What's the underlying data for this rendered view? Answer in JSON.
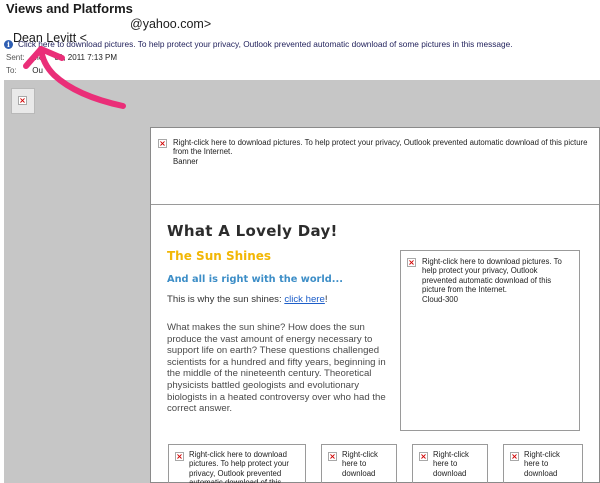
{
  "message": {
    "subject": "Views and Platforms",
    "sender_name": "Dean Levitt <",
    "sender_domain": "@yahoo.com>",
    "infobar_text": "Click here to download pictures. To help protect your privacy, Outlook prevented automatic download of some pictures in this message.",
    "sent_label": "Sent:",
    "sent_value": "Mo     31, 2011 7:13 PM",
    "to_label": "To:",
    "to_value": "Ou"
  },
  "newsletter": {
    "banner_placeholder": "Right-click here to download pictures.  To help protect your privacy, Outlook prevented automatic download of this picture from the Internet.",
    "banner_alt": "Banner",
    "headline": "What A Lovely Day!",
    "sun_title": "The Sun Shines",
    "right_title": "And all is right with the world...",
    "why_prefix": "This is why the sun shines: ",
    "why_link": "click here",
    "why_suffix": "!",
    "paragraph": "What makes the sun shine? How does the sun produce the vast amount of energy necessary to support life on earth? These questions challenged scientists for a hundred and fifty years, beginning in the middle of the nineteenth century. Theoretical physicists battled geologists and evolutionary biologists in a heated controversy over who had the correct answer.",
    "cloud_placeholder": "Right-click here to download pictures.  To help protect your privacy, Outlook prevented automatic download of this picture from the Internet.",
    "cloud_alt": "Cloud-300",
    "bottom_placeholder_1": "Right-click here to download pictures.  To help protect your privacy, Outlook prevented automatic download of this",
    "bottom_placeholder_2": "Right-click here to download",
    "bottom_placeholder_3": "Right-click here to download",
    "bottom_placeholder_4": "Right-click here to download"
  },
  "icons": {
    "info": "info-icon",
    "broken_image": "broken-image-icon",
    "annotation": "pink-arrow-annotation"
  },
  "colors": {
    "accent_yellow": "#f2b705",
    "accent_blue": "#3d8ec7",
    "link_blue": "#1d5ec9",
    "annotation_pink": "#ea2e78",
    "body_grey": "#c6c6c6"
  }
}
